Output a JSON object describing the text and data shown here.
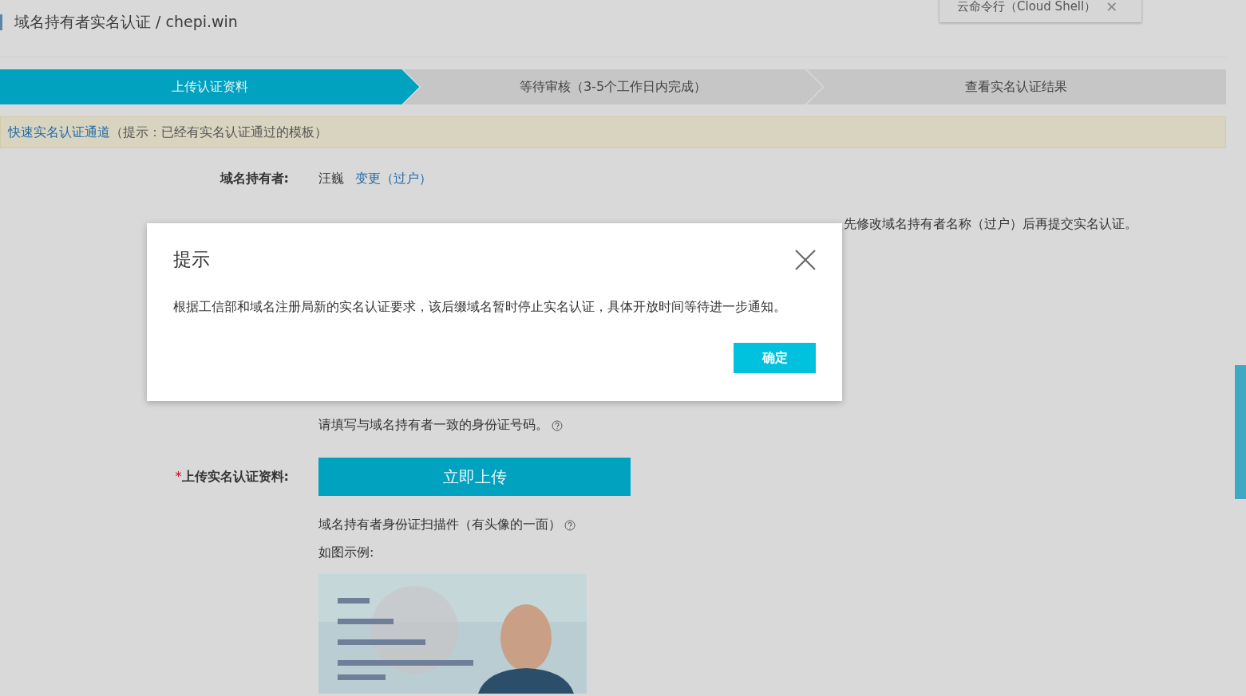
{
  "header": {
    "title": "域名持有者实名认证 / chepi.win"
  },
  "cloud_shell": {
    "label": "云命令行（Cloud Shell）",
    "close": "✕"
  },
  "steps": [
    {
      "label": "上传认证资料",
      "selected": true
    },
    {
      "label": "等待审核（3-5个工作日内完成）",
      "selected": false
    },
    {
      "label": "查看实名认证结果",
      "selected": false
    }
  ],
  "notice": {
    "link": "快速实名认证通道",
    "text": "（提示：已经有实名认证通过的模板）"
  },
  "owner": {
    "label": "域名持有者:",
    "name": "汪巍",
    "change_link": "变更（过户）"
  },
  "reminder_visible": "先修改域名持有者名称（过户）后再提交实名认证。",
  "id_hint": "请填写与域名持有者一致的身份证号码。",
  "upload": {
    "required_mark": "*",
    "label": "上传实名认证资料:",
    "button": "立即上传",
    "hint": "域名持有者身份证扫描件（有头像的一面）",
    "example_label": "如图示例:"
  },
  "dialog": {
    "title": "提示",
    "message": "根据工信部和域名注册局新的实名认证要求，该后缀域名暂时停止实名认证，具体开放时间等待进一步通知。",
    "ok": "确定"
  }
}
